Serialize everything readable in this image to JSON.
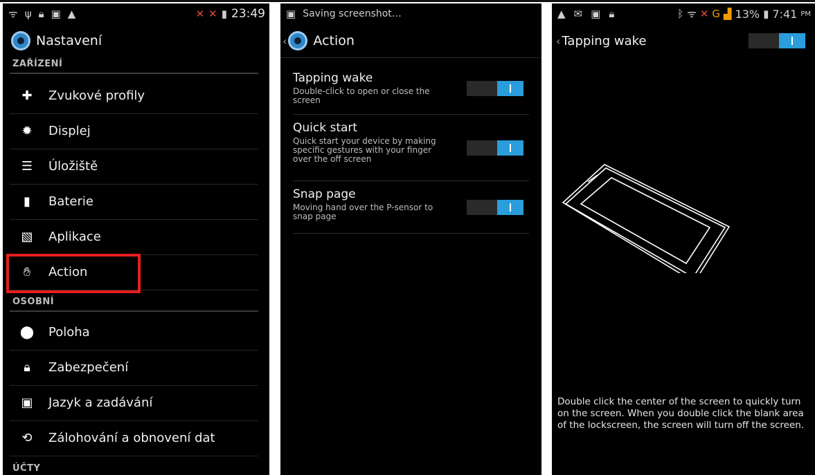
{
  "screen1": {
    "status": {
      "time": "23:49"
    },
    "title": "Nastavení",
    "section_device": "ZAŘÍZENÍ",
    "items_device": [
      {
        "label": "Zvukové profily",
        "icon": "sound-profile-icon"
      },
      {
        "label": "Displej",
        "icon": "display-icon"
      },
      {
        "label": "Úložiště",
        "icon": "storage-icon"
      },
      {
        "label": "Baterie",
        "icon": "battery-icon"
      },
      {
        "label": "Aplikace",
        "icon": "apps-icon"
      },
      {
        "label": "Action",
        "icon": "hand-icon"
      }
    ],
    "section_personal": "OSOBNÍ",
    "items_personal": [
      {
        "label": "Poloha",
        "icon": "location-pin-icon"
      },
      {
        "label": "Zabezpečení",
        "icon": "lock-icon"
      },
      {
        "label": "Jazyk a zadávání",
        "icon": "keyboard-icon"
      },
      {
        "label": "Zálohování a obnovení dat",
        "icon": "backup-icon"
      }
    ],
    "section_accounts": "ÚČTY",
    "highlight_color": "#e61e1e"
  },
  "screen2": {
    "status": {
      "text": "Saving screenshot…"
    },
    "title": "Action",
    "rows": [
      {
        "title": "Tapping wake",
        "desc": "Double-click to open or close the screen",
        "on": true
      },
      {
        "title": "Quick start",
        "desc": "Quick start your device by making specific gestures with your finger over the off screen",
        "on": true
      },
      {
        "title": "Snap page",
        "desc": "Moving hand over the P-sensor to snap page",
        "on": true
      }
    ],
    "accent": "#2a9ddc"
  },
  "screen3": {
    "status": {
      "battery": "13%",
      "time": "7:41",
      "ampm": "PM",
      "network": "G"
    },
    "title": "Tapping wake",
    "toggle_on": true,
    "description": "Double click the center of the screen to quickly turn on the screen. When you double click the blank area of the lockscreen, the screen will turn off the screen."
  }
}
